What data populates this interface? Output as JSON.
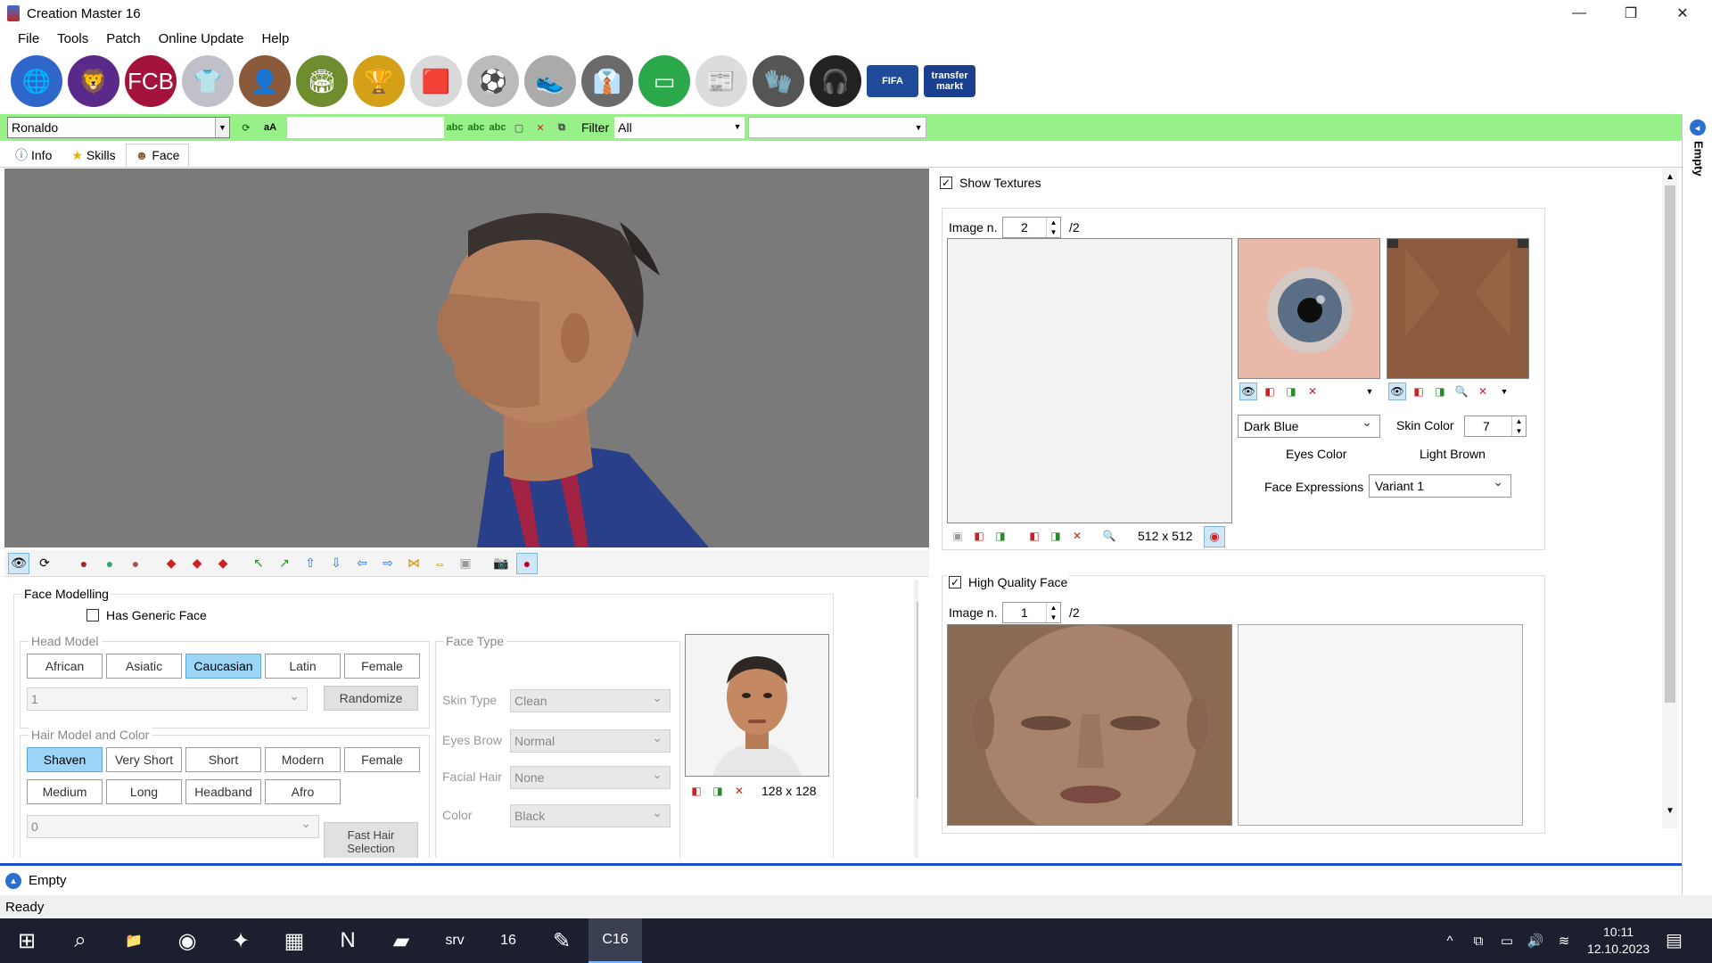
{
  "window": {
    "title": "Creation Master 16",
    "minimize": "—",
    "maximize": "❐",
    "close": "✕"
  },
  "menu": [
    "File",
    "Tools",
    "Patch",
    "Online Update",
    "Help"
  ],
  "toolbar_icons": [
    {
      "name": "world-globe-icon",
      "glyph": "🌐",
      "color": "#2f66c9"
    },
    {
      "name": "premier-league-icon",
      "glyph": "🦁",
      "color": "#5a2a8a"
    },
    {
      "name": "fc-barcelona-icon",
      "glyph": "FCB",
      "color": "#a4133c"
    },
    {
      "name": "kit-shirt-icon",
      "glyph": "👕",
      "color": "#c0c0c8"
    },
    {
      "name": "player-icon",
      "glyph": "👤",
      "color": "#8a5a3a"
    },
    {
      "name": "stadium-icon",
      "glyph": "🏟",
      "color": "#6f8c2f"
    },
    {
      "name": "world-cup-trophy-icon",
      "glyph": "🏆",
      "color": "#d4a017"
    },
    {
      "name": "referee-cards-icon",
      "glyph": "🟥",
      "color": "#d9d9d9"
    },
    {
      "name": "ball-icon",
      "glyph": "⚽",
      "color": "#bbbbbb"
    },
    {
      "name": "boots-icon",
      "glyph": "👟",
      "color": "#aaaaaa"
    },
    {
      "name": "manager-icon",
      "glyph": "👔",
      "color": "#6a6a6a"
    },
    {
      "name": "pitch-icon",
      "glyph": "▭",
      "color": "#2aa84a"
    },
    {
      "name": "newspaper-icon",
      "glyph": "📰",
      "color": "#dcdcdc"
    },
    {
      "name": "goalkeeper-gloves-icon",
      "glyph": "🧤",
      "color": "#555555"
    },
    {
      "name": "headphones-icon",
      "glyph": "🎧",
      "color": "#222222"
    },
    {
      "name": "fifa-cover-icon",
      "glyph": "FIFA",
      "color": "#1e4c9a"
    },
    {
      "name": "transfermarkt-icon",
      "glyph": "transfer markt",
      "color": "#1b3f8f"
    }
  ],
  "search": {
    "player_value": "Ronaldo",
    "case_label": "aA",
    "filter_label": "Filter",
    "filter_value": "All",
    "second_combo_value": ""
  },
  "tabs": [
    {
      "label": "Info",
      "icon": "info-icon",
      "glyph": "ⓘ"
    },
    {
      "label": "Skills",
      "icon": "star-icon",
      "glyph": "★"
    },
    {
      "label": "Face",
      "icon": "face-icon",
      "glyph": "☻"
    }
  ],
  "face_modelling": {
    "title": "Face Modelling",
    "has_generic_face": "Has Generic Face",
    "head_model_label": "Head Model",
    "head_models": [
      "African",
      "Asiatic",
      "Caucasian",
      "Latin",
      "Female"
    ],
    "head_selected": "Caucasian",
    "head_number": "1",
    "randomize": "Randomize",
    "hair_label": "Hair Model and Color",
    "hair_row1": [
      "Shaven",
      "Very Short",
      "Short",
      "Modern",
      "Female"
    ],
    "hair_row2": [
      "Medium",
      "Long",
      "Headband",
      "Afro"
    ],
    "hair_selected": "Shaven",
    "hair_number": "0",
    "fast_hair": "Fast Hair Selection",
    "face_type_label": "Face Type",
    "skin_type_label": "Skin Type",
    "skin_type": "Clean",
    "eyes_brow_label": "Eyes Brow",
    "eyes_brow": "Normal",
    "facial_hair_label": "Facial Hair",
    "facial_hair": "None",
    "color_label": "Color",
    "color": "Black",
    "photo_size": "128 x 128"
  },
  "textures": {
    "show_textures": "Show Textures",
    "image_n_label": "Image n.",
    "image_n": "2",
    "image_total": "/2",
    "size": "512 x 512",
    "eyes_value": "Dark Blue",
    "eyes_label": "Eyes Color",
    "skin_color_label": "Skin Color",
    "skin_color_value": "7",
    "skin_color_name": "Light Brown",
    "face_expr_label": "Face Expressions",
    "face_expr_value": "Variant 1"
  },
  "hq": {
    "label": "High Quality Face",
    "image_n_label": "Image n.",
    "image_n": "1",
    "image_total": "/2"
  },
  "status": {
    "panel": "Empty",
    "ready": "Ready",
    "side": "Empty"
  },
  "taskbar": {
    "time": "10:11",
    "date": "12.10.2023",
    "apps": [
      {
        "name": "start-icon",
        "glyph": "⊞"
      },
      {
        "name": "search-icon",
        "glyph": "⌕"
      },
      {
        "name": "file-explorer-icon",
        "glyph": "📁"
      },
      {
        "name": "chrome-icon",
        "glyph": "◉"
      },
      {
        "name": "fox-app-icon",
        "glyph": "✦"
      },
      {
        "name": "store-icon",
        "glyph": "▦"
      },
      {
        "name": "netflix-icon",
        "glyph": "N"
      },
      {
        "name": "sticky-notes-icon",
        "glyph": "▰"
      },
      {
        "name": "srv-app-icon",
        "glyph": "srv"
      },
      {
        "name": "fifa16-icon",
        "glyph": "16"
      },
      {
        "name": "paint-icon",
        "glyph": "✎"
      },
      {
        "name": "creation-master-icon",
        "glyph": "C16"
      }
    ],
    "tray": [
      {
        "name": "chevron-up-icon",
        "glyph": "^"
      },
      {
        "name": "network-device-icon",
        "glyph": "⧉"
      },
      {
        "name": "battery-icon",
        "glyph": "▭"
      },
      {
        "name": "volume-icon",
        "glyph": "🔊"
      },
      {
        "name": "wifi-icon",
        "glyph": "≋"
      }
    ]
  }
}
